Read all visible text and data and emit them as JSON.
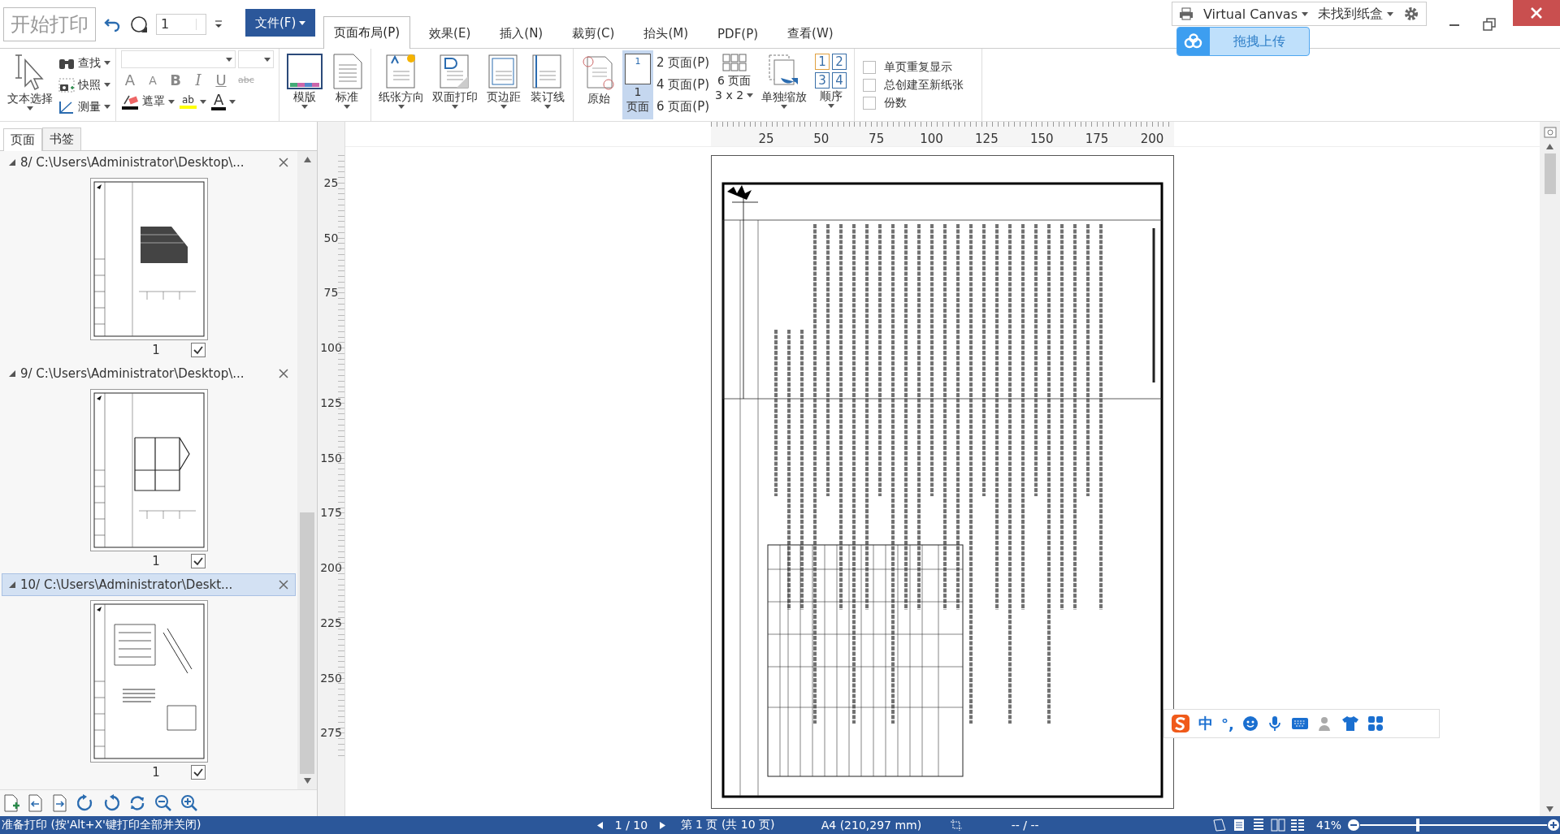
{
  "quick_access": {
    "print_button": "开始打印",
    "copies": "1"
  },
  "file_menu": "文件(F)",
  "tabs": [
    {
      "label": "页面布局(P)",
      "selected": true
    },
    {
      "label": "效果(E)",
      "selected": false
    },
    {
      "label": "插入(N)",
      "selected": false
    },
    {
      "label": "裁剪(C)",
      "selected": false
    },
    {
      "label": "抬头(M)",
      "selected": false
    },
    {
      "label": "PDF(P)",
      "selected": false
    },
    {
      "label": "查看(W)",
      "selected": false
    }
  ],
  "printer": {
    "name": "Virtual Canvas",
    "tray": "未找到纸盒"
  },
  "cloud_upload": "拖拽上传",
  "ribbon": {
    "select_tool": "文本选择",
    "tools": [
      "查找",
      "快照",
      "测量"
    ],
    "font_buttons": [
      "A",
      "A",
      "B",
      "I",
      "U",
      "abc"
    ],
    "mask": "遮罩",
    "highlight": "ab",
    "font_color": "A",
    "templates": [
      "模版",
      "标准"
    ],
    "paper": [
      "纸张方向",
      "双面打印",
      "页边距",
      "装订线"
    ],
    "original": "原始",
    "one_page": {
      "icon_number": "1",
      "number": "1",
      "label": "页面",
      "selected": true
    },
    "multi_pages": [
      "2 页面(P)",
      "4 页面(P)",
      "6 页面(P)"
    ],
    "six_pages": {
      "label": "6 页面",
      "grid": "3 x 2"
    },
    "scale": "单独缩放",
    "order": {
      "label": "顺序",
      "digits": [
        "1",
        "2",
        "3",
        "4"
      ]
    },
    "checks": [
      {
        "label": "单页重复显示",
        "checked": false
      },
      {
        "label": "总创建至新纸张",
        "checked": false
      },
      {
        "label": "份数",
        "checked": false
      }
    ]
  },
  "left_panel": {
    "tabs": [
      {
        "label": "页面",
        "selected": true
      },
      {
        "label": "书签",
        "selected": false
      }
    ],
    "files": [
      {
        "title": "8/ C:\\Users\\Administrator\\Desktop\\...",
        "selected": false,
        "pages": [
          {
            "number": "1",
            "checked": true
          }
        ]
      },
      {
        "title": "9/ C:\\Users\\Administrator\\Desktop\\...",
        "selected": false,
        "pages": [
          {
            "number": "1",
            "checked": true
          }
        ]
      },
      {
        "title": "10/ C:\\Users\\Administrator\\Deskt...",
        "selected": true,
        "pages": [
          {
            "number": "1",
            "checked": true
          }
        ]
      }
    ]
  },
  "rulers": {
    "horizontal": [
      "25",
      "50",
      "75",
      "100",
      "125",
      "150",
      "175",
      "200"
    ],
    "vertical": [
      "25",
      "50",
      "75",
      "100",
      "125",
      "150",
      "175",
      "200",
      "225",
      "250",
      "275"
    ]
  },
  "ime_bar": {
    "mode": "中",
    "punctuation": "°,"
  },
  "status_bar": {
    "message": "准备打印 (按'Alt+X'键打印全部并关闭)",
    "page_nav": "1 / 10",
    "page_info": "第 1 页 (共 10 页)",
    "paper": "A4 (210,297 mm)",
    "coords": "-- / --",
    "zoom": "41%",
    "zoom_slider": {
      "level": 0.3
    }
  }
}
